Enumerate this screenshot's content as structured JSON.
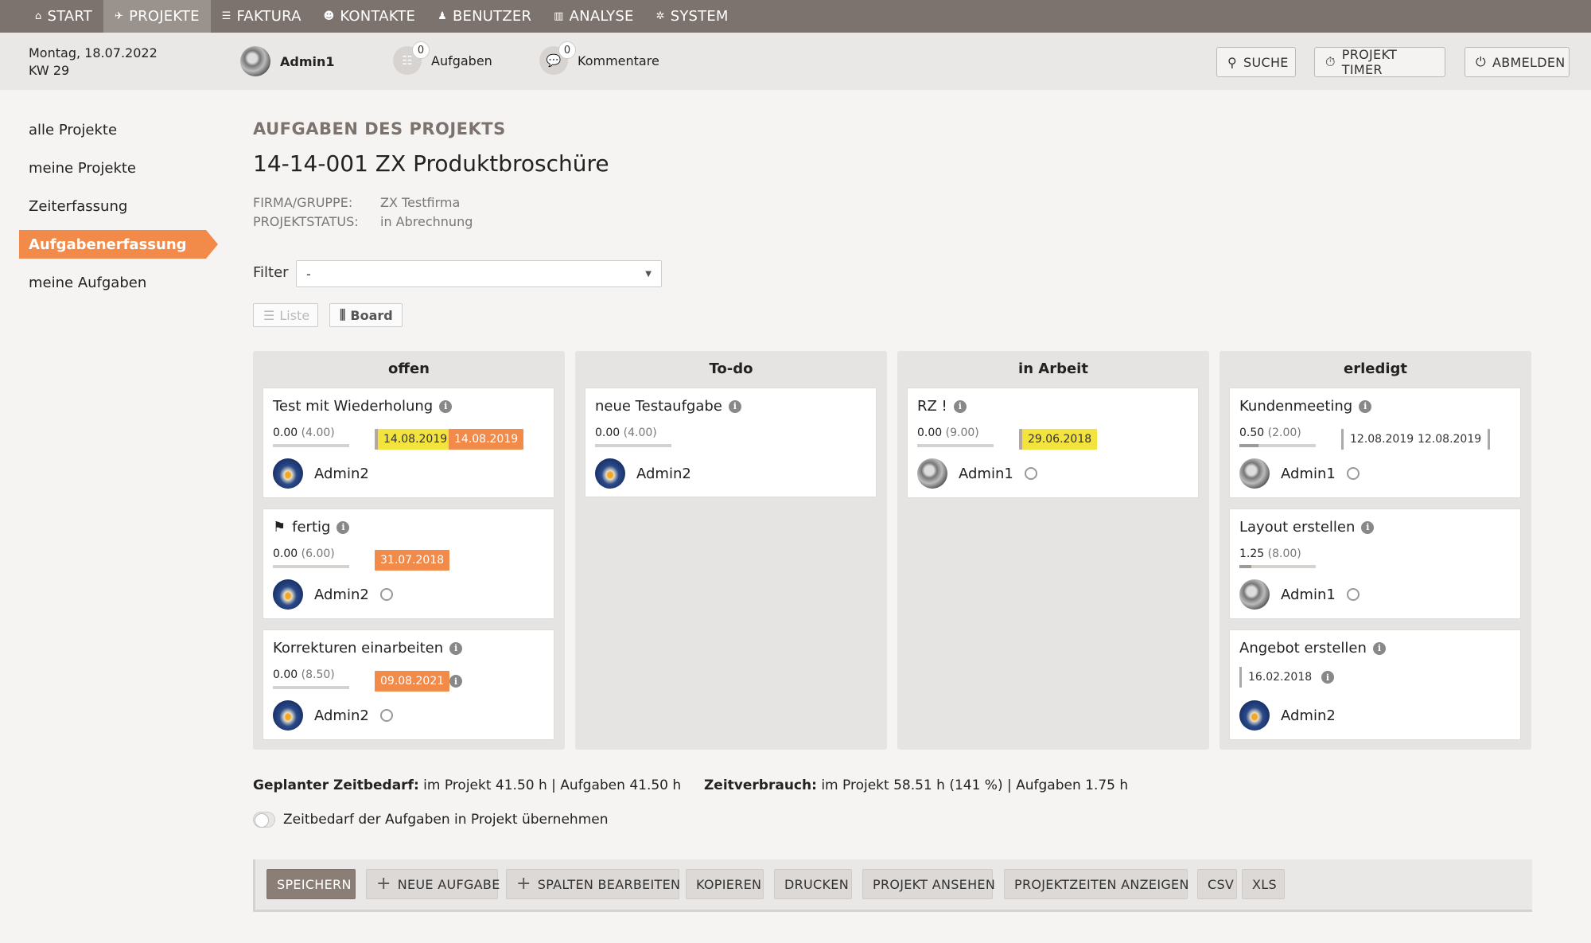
{
  "topnav": [
    {
      "label": "START",
      "icon": "home-icon",
      "glyph": "⌂"
    },
    {
      "label": "PROJEKTE",
      "icon": "rocket-icon",
      "glyph": "✈",
      "active": true
    },
    {
      "label": "FAKTURA",
      "icon": "invoice-icon",
      "glyph": "☰"
    },
    {
      "label": "KONTAKTE",
      "icon": "contacts-icon",
      "glyph": "☻"
    },
    {
      "label": "BENUTZER",
      "icon": "user-icon",
      "glyph": "♟"
    },
    {
      "label": "ANALYSE",
      "icon": "chart-icon",
      "glyph": "▥"
    },
    {
      "label": "SYSTEM",
      "icon": "gear-icon",
      "glyph": "✲"
    }
  ],
  "header": {
    "date": "Montag, 18.07.2022",
    "week": "KW 29",
    "user": "Admin1",
    "tasks": {
      "label": "Aufgaben",
      "count": "0"
    },
    "comments": {
      "label": "Kommentare",
      "count": "0"
    },
    "search": "SUCHE",
    "timer": "PROJEKT TIMER",
    "logout": "ABMELDEN"
  },
  "sidebar": [
    {
      "label": "alle Projekte"
    },
    {
      "label": "meine Projekte"
    },
    {
      "label": "Zeiterfassung"
    },
    {
      "label": "Aufgabenerfassung",
      "active": true
    },
    {
      "label": "meine Aufgaben"
    }
  ],
  "main": {
    "section_title": "AUFGABEN DES PROJEKTS",
    "project_title": "14-14-001 ZX Produktbroschüre",
    "firma_label": "FIRMA/GRUPPE:",
    "firma_value": "ZX Testfirma",
    "status_label": "PROJEKTSTATUS:",
    "status_value": "in Abrechnung",
    "filter_label": "Filter",
    "filter_value": "-",
    "view_list": "Liste",
    "view_board": "Board"
  },
  "board": {
    "columns": [
      {
        "title": "offen",
        "cards": [
          {
            "title": "Test mit Wiederholung",
            "hours": "0.00",
            "planned": "(4.00)",
            "progress": 0,
            "badges": [
              {
                "text": "14.08.2019",
                "type": "yellow"
              },
              {
                "text": "14.08.2019",
                "type": "orange"
              }
            ],
            "assignee": "Admin2",
            "avatar": "av2",
            "user_icon": false
          },
          {
            "title": "fertig",
            "flag": true,
            "hours": "0.00",
            "planned": "(6.00)",
            "progress": 0,
            "badges": [
              {
                "text": "31.07.2018",
                "type": "orange"
              }
            ],
            "assignee": "Admin2",
            "avatar": "av2",
            "user_icon": true
          },
          {
            "title": "Korrekturen einarbeiten",
            "hours": "0.00",
            "planned": "(8.50)",
            "progress": 0,
            "badges": [
              {
                "text": "09.08.2021",
                "type": "orange"
              }
            ],
            "badge_info": true,
            "assignee": "Admin2",
            "avatar": "av2",
            "user_icon": true
          }
        ]
      },
      {
        "title": "To-do",
        "cards": [
          {
            "title": "neue Testaufgabe",
            "hours": "0.00",
            "planned": "(4.00)",
            "progress": 0,
            "badges": [],
            "assignee": "Admin2",
            "avatar": "av2",
            "user_icon": false
          }
        ]
      },
      {
        "title": "in Arbeit",
        "cards": [
          {
            "title": "RZ !",
            "hours": "0.00",
            "planned": "(9.00)",
            "progress": 0,
            "badges": [
              {
                "text": "29.06.2018",
                "type": "yellow"
              }
            ],
            "assignee": "Admin1",
            "avatar": "av1",
            "user_icon": true
          }
        ]
      },
      {
        "title": "erledigt",
        "cards": [
          {
            "title": "Kundenmeeting",
            "hours": "0.50",
            "planned": "(2.00)",
            "progress": 0.25,
            "dates": [
              "12.08.2019",
              "12.08.2019"
            ],
            "assignee": "Admin1",
            "avatar": "av1",
            "user_icon": true
          },
          {
            "title": "Layout erstellen",
            "hours": "1.25",
            "planned": "(8.00)",
            "progress": 0.16,
            "assignee": "Admin1",
            "avatar": "av1",
            "user_icon": true
          },
          {
            "title": "Angebot erstellen",
            "no_hours": true,
            "single_date": "16.02.2018",
            "assignee": "Admin2",
            "avatar": "av2",
            "user_icon": false
          }
        ]
      }
    ]
  },
  "summary": {
    "planned_label": "Geplanter Zeitbedarf:",
    "planned_text": "im Projekt 41.50 h | Aufgaben 41.50 h",
    "used_label": "Zeitverbrauch:",
    "used_text": "im Projekt 58.51 h (141 %) | Aufgaben 1.75 h",
    "toggle_label": "Zeitbedarf der Aufgaben in Projekt übernehmen"
  },
  "bottombar": {
    "save": "SPEICHERN",
    "new_task": "NEUE AUFGABE",
    "edit_columns": "SPALTEN BEARBEITEN",
    "copy": "KOPIEREN",
    "print": "DRUCKEN",
    "view_project": "PROJEKT ANSEHEN",
    "show_times": "PROJEKTZEITEN ANZEIGEN",
    "csv": "CSV",
    "xls": "XLS"
  }
}
